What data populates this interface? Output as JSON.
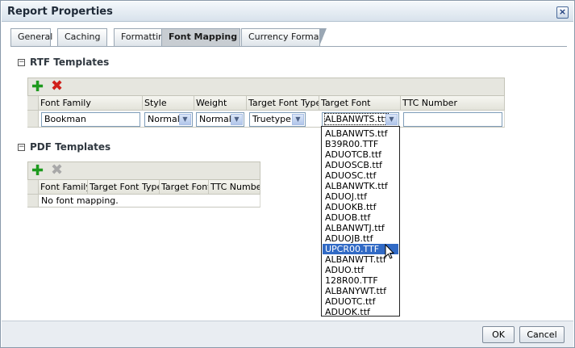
{
  "dialog": {
    "title": "Report Properties",
    "close_glyph": "×"
  },
  "tabs": [
    {
      "label": "General",
      "active": false
    },
    {
      "label": "Caching",
      "active": false
    },
    {
      "label": "Formatting",
      "active": false
    },
    {
      "label": "Font Mapping",
      "active": true
    },
    {
      "label": "Currency Format",
      "active": false
    }
  ],
  "rtf": {
    "title": "RTF Templates",
    "toggle": "−",
    "columns": [
      "Font Family",
      "Style",
      "Weight",
      "Target Font Type",
      "Target Font",
      "TTC Number"
    ],
    "row": {
      "font_family": "Bookman",
      "style": "Normal",
      "weight": "Normal",
      "target_font_type": "Truetype",
      "target_font": "ALBANWTS.ttf",
      "ttc_number": ""
    }
  },
  "pdf": {
    "title": "PDF Templates",
    "toggle": "−",
    "columns": [
      "Font Family",
      "Target Font Type",
      "Target Font",
      "TTC Number"
    ],
    "empty_text": "No font mapping."
  },
  "font_dropdown": {
    "options": [
      "ALBANWTS.ttf",
      "B39R00.TTF",
      "ADUOTCB.ttf",
      "ADUOSCB.ttf",
      "ADUOSC.ttf",
      "ALBANWTK.ttf",
      "ADUOJ.ttf",
      "ADUOKB.ttf",
      "ADUOB.ttf",
      "ALBANWTJ.ttf",
      "ADUOJB.ttf",
      "UPCR00.TTF",
      "ALBANWTT.ttf",
      "ADUO.ttf",
      "128R00.TTF",
      "ALBANYWT.ttf",
      "ADUOTC.ttf",
      "ADUOK.ttf"
    ],
    "highlighted": "UPCR00.TTF"
  },
  "footer": {
    "ok_label": "OK",
    "cancel_label": "Cancel"
  },
  "icons": {
    "add": "add-icon",
    "delete": "delete-icon",
    "dropdown_arrow": "▼"
  }
}
